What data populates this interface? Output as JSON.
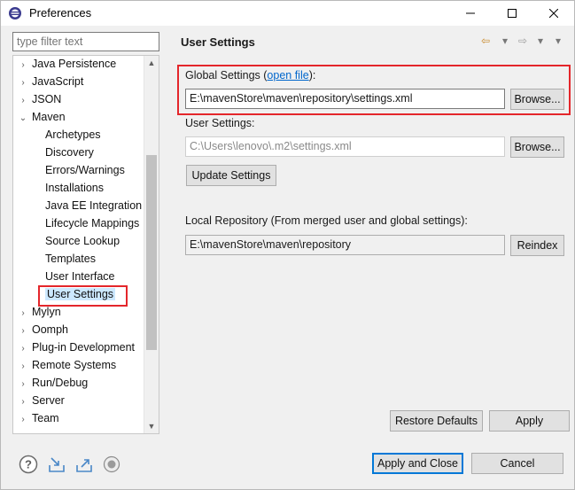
{
  "window": {
    "title": "Preferences"
  },
  "filter": {
    "placeholder": "type filter text"
  },
  "tree": {
    "items": [
      {
        "label": "Java Persistence",
        "arrow": "›"
      },
      {
        "label": "JavaScript",
        "arrow": "›"
      },
      {
        "label": "JSON",
        "arrow": "›"
      },
      {
        "label": "Maven",
        "arrow": "⌄"
      },
      {
        "label": "Archetypes",
        "arrow": ""
      },
      {
        "label": "Discovery",
        "arrow": ""
      },
      {
        "label": "Errors/Warnings",
        "arrow": ""
      },
      {
        "label": "Installations",
        "arrow": ""
      },
      {
        "label": "Java EE Integration",
        "arrow": ""
      },
      {
        "label": "Lifecycle Mappings",
        "arrow": ""
      },
      {
        "label": "Source Lookup",
        "arrow": ""
      },
      {
        "label": "Templates",
        "arrow": ""
      },
      {
        "label": "User Interface",
        "arrow": ""
      },
      {
        "label": "User Settings",
        "arrow": "",
        "selected": true
      },
      {
        "label": "Mylyn",
        "arrow": "›"
      },
      {
        "label": "Oomph",
        "arrow": "›"
      },
      {
        "label": "Plug-in Development",
        "arrow": "›"
      },
      {
        "label": "Remote Systems",
        "arrow": "›"
      },
      {
        "label": "Run/Debug",
        "arrow": "›"
      },
      {
        "label": "Server",
        "arrow": "›"
      },
      {
        "label": "Team",
        "arrow": "›"
      }
    ]
  },
  "page": {
    "title": "User Settings",
    "global_label": "Global Settings (",
    "global_link": "open file",
    "global_label_end": "):",
    "global_value": "E:\\mavenStore\\maven\\repository\\settings.xml",
    "user_label": "User Settings:",
    "user_value": "C:\\Users\\lenovo\\.m2\\settings.xml",
    "browse_label": "Browse...",
    "update_label": "Update Settings",
    "local_repo_label": "Local Repository (From merged user and global settings):",
    "local_repo_value": "E:\\mavenStore\\maven\\repository",
    "reindex_label": "Reindex",
    "restore_label": "Restore Defaults",
    "apply_label": "Apply"
  },
  "footer": {
    "apply_close_label": "Apply and Close",
    "cancel_label": "Cancel"
  },
  "colors": {
    "highlight": "#e4262b",
    "link": "#0066cc",
    "selection": "#cce8ff"
  }
}
